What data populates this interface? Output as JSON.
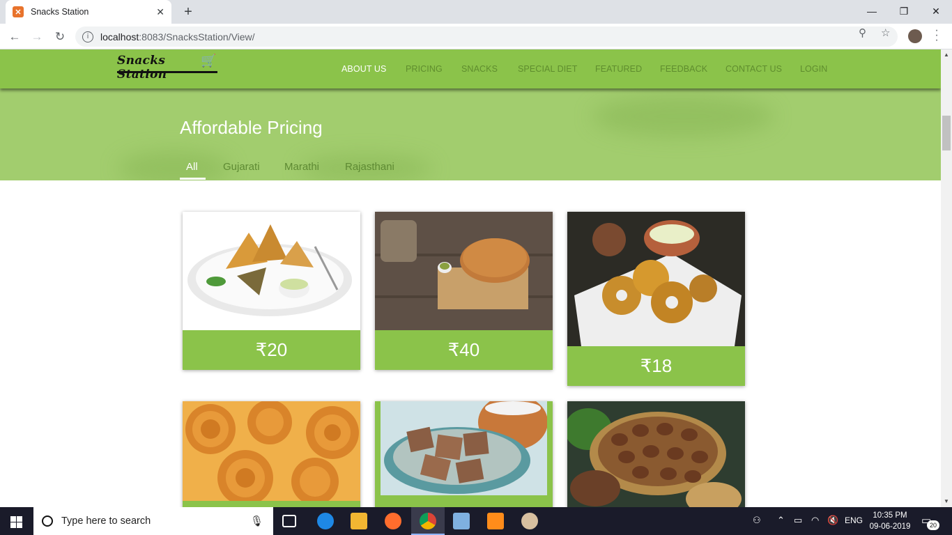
{
  "browser": {
    "tab_title": "Snacks Station",
    "url_host": "localhost",
    "url_path": ":8083/SnacksStation/View/"
  },
  "site": {
    "logo_text": "Snacks Station",
    "nav": [
      {
        "label": "ABOUT US",
        "active": true
      },
      {
        "label": "PRICING",
        "active": false
      },
      {
        "label": "SNACKS",
        "active": false
      },
      {
        "label": "SPECIAL DIET",
        "active": false
      },
      {
        "label": "FEATURED",
        "active": false
      },
      {
        "label": "FEEDBACK",
        "active": false
      },
      {
        "label": "CONTACT US",
        "active": false
      },
      {
        "label": "LOGIN",
        "active": false
      }
    ]
  },
  "pricing": {
    "title": "Affordable Pricing",
    "filters": [
      {
        "label": "All",
        "active": true
      },
      {
        "label": "Gujarati",
        "active": false
      },
      {
        "label": "Marathi",
        "active": false
      },
      {
        "label": "Rajasthani",
        "active": false
      }
    ],
    "cards": [
      {
        "name": "samosa",
        "price": "₹20"
      },
      {
        "name": "khakhra",
        "price": "₹40"
      },
      {
        "name": "medu-vada",
        "price": "₹18"
      },
      {
        "name": "chakli",
        "price": ""
      },
      {
        "name": "crackers",
        "price": ""
      },
      {
        "name": "bhakarwadi",
        "price": ""
      }
    ]
  },
  "taskbar": {
    "search_placeholder": "Type here to search",
    "language": "ENG",
    "time": "10:35 PM",
    "date": "09-06-2019",
    "notification_count": "20"
  },
  "colors": {
    "nav_green": "#8bc34a",
    "hero_green": "#a2cd6e",
    "nav_link_inactive": "#5f8d2e"
  }
}
